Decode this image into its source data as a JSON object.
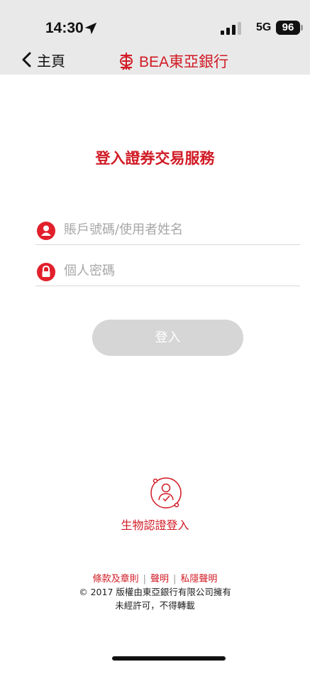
{
  "status_bar": {
    "time": "14:30",
    "network": "5G",
    "battery": "96"
  },
  "nav": {
    "back_label": "主頁",
    "brand_text": "BEA東亞銀行"
  },
  "title": "登入證券交易服務",
  "form": {
    "username_placeholder": "賬戶號碼/使用者姓名",
    "password_placeholder": "個人密碼",
    "login_label": "登入"
  },
  "biometric": {
    "label": "生物認證登入"
  },
  "footer": {
    "links": [
      "條款及章則",
      "聲明",
      "私隱聲明"
    ],
    "copyright": "© 2017 版權由東亞銀行有限公司擁有",
    "notice": "未經許可，不得轉載"
  },
  "colors": {
    "brand_red": "#d11a24",
    "header_bg": "#e9e9e9",
    "button_disabled": "#d6d6d6"
  },
  "icons": [
    "location-arrow-icon",
    "signal-icon",
    "back-chevron-icon",
    "bea-logo-icon",
    "user-icon",
    "lock-icon",
    "biometric-icon"
  ]
}
